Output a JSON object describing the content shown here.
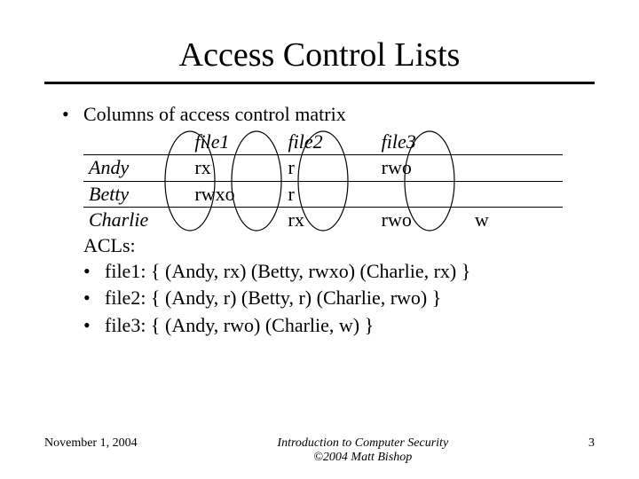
{
  "title": "Access Control Lists",
  "bullet_intro": "Columns of access control matrix",
  "matrix": {
    "headers": [
      "",
      "file1",
      "file2",
      "file3",
      ""
    ],
    "rows": [
      {
        "name": "Andy",
        "cells": [
          "rx",
          "r",
          "rwo",
          ""
        ]
      },
      {
        "name": "Betty",
        "cells": [
          "rwxo",
          "r",
          "",
          ""
        ]
      },
      {
        "name": "Charlie",
        "cells": [
          "",
          "rx",
          "rwo",
          "w"
        ]
      }
    ]
  },
  "acls_label": "ACLs:",
  "acl_lines": [
    "file1: { (Andy, rx) (Betty, rwxo) (Charlie, rx) }",
    "file2: { (Andy, r) (Betty, r) (Charlie, rwo) }",
    "file3: { (Andy, rwo) (Charlie, w) }"
  ],
  "footer": {
    "date": "November 1, 2004",
    "center1": "Introduction to Computer Security",
    "center2": "©2004 Matt Bishop",
    "page": "3"
  }
}
